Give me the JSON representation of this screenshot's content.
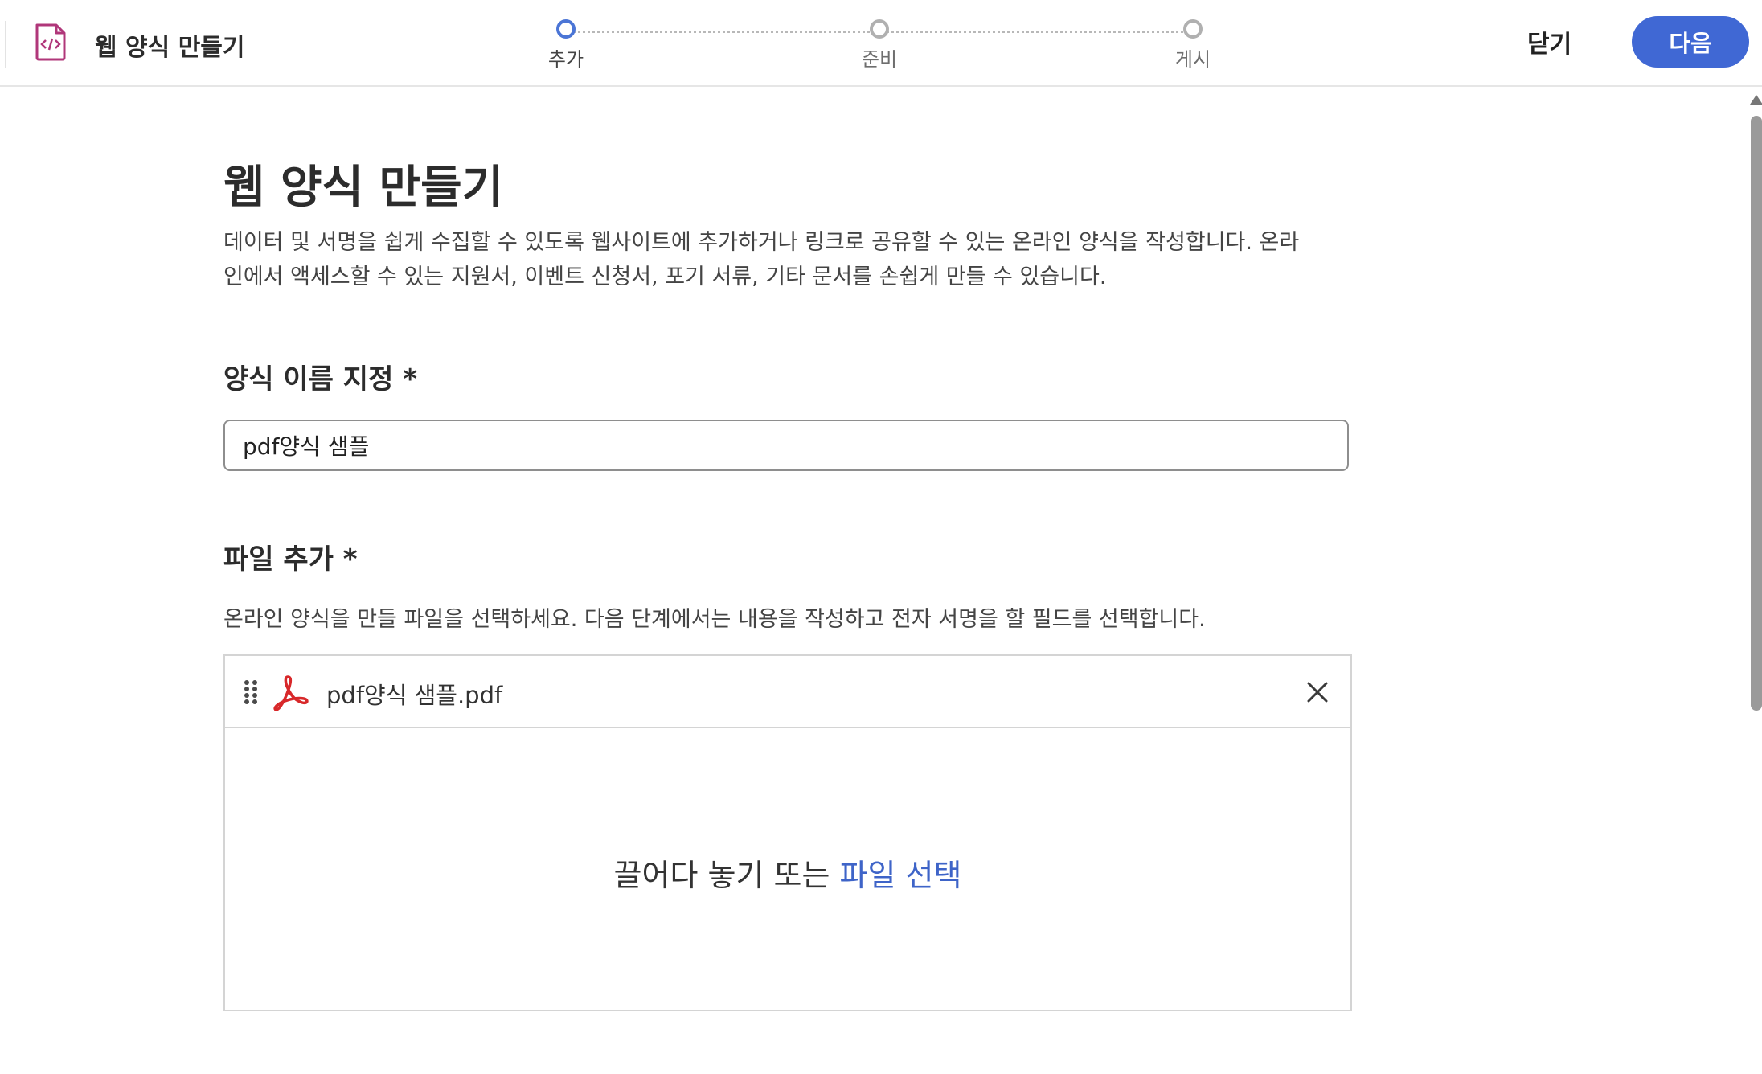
{
  "header": {
    "app_title": "웹 양식 만들기",
    "app_icon": "code-file-icon",
    "steps": [
      {
        "label": "추가",
        "active": true
      },
      {
        "label": "준비",
        "active": false
      },
      {
        "label": "게시",
        "active": false
      }
    ],
    "close_label": "닫기",
    "next_label": "다음"
  },
  "main": {
    "title": "웹 양식 만들기",
    "description": "데이터 및 서명을 쉽게 수집할 수 있도록 웹사이트에 추가하거나 링크로 공유할 수 있는 온라인 양식을 작성합니다. 온라인에서 액세스할 수 있는 지원서, 이벤트 신청서, 포기 서류, 기타 문서를 손쉽게 만들 수 있습니다.",
    "name_section": {
      "label": "양식 이름 지정 *",
      "value": "pdf양식 샘플"
    },
    "file_section": {
      "label": "파일 추가 *",
      "description": "온라인 양식을 만들 파일을 선택하세요. 다음 단계에서는 내용을 작성하고 전자 서명을 할 필드를 선택합니다.",
      "file_name": "pdf양식 샘플.pdf",
      "drop_text": "끌어다 놓기 또는 ",
      "drop_link": "파일 선택"
    }
  },
  "colors": {
    "accent": "#4068d4",
    "link": "#3e64c8",
    "pdf_red": "#d8282a",
    "icon_magenta": "#b0377a"
  }
}
